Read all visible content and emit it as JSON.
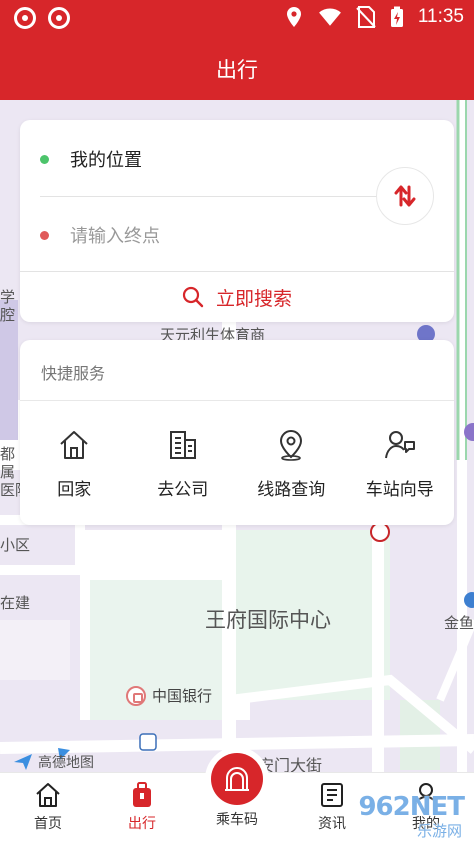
{
  "status_bar": {
    "time": "11:35"
  },
  "header": {
    "title": "出行"
  },
  "route": {
    "origin_label": "我的位置",
    "destination_placeholder": "请输入终点",
    "search_label": "立即搜索"
  },
  "quick_services": {
    "title": "快捷服务",
    "items": [
      {
        "label": "回家",
        "icon": "home-icon"
      },
      {
        "label": "去公司",
        "icon": "office-building-icon"
      },
      {
        "label": "线路查询",
        "icon": "location-pin-icon"
      },
      {
        "label": "车站向导",
        "icon": "guide-person-icon"
      }
    ]
  },
  "map": {
    "labels": {
      "sports_mall": "天元利生体育商",
      "center": "王府国际中心",
      "bank": "中国银行",
      "street": "安门大街",
      "left_1": "学",
      "left_2": "腔",
      "left_3": "都",
      "left_4": "属",
      "left_5": "医院",
      "left_6": "小区",
      "left_7": "在建",
      "right_1": "金鱼",
      "provider": "高德地图"
    }
  },
  "bottom_nav": {
    "items": [
      {
        "label": "首页"
      },
      {
        "label": "出行"
      },
      {
        "label": "乘车码"
      },
      {
        "label": "资讯"
      },
      {
        "label": "我的"
      }
    ]
  },
  "watermark": {
    "text": "962NET",
    "sub": "乐游网"
  },
  "colors": {
    "brand": "#d7262a",
    "origin_dot": "#4cc46b",
    "dest_dot": "#e05a5a"
  }
}
